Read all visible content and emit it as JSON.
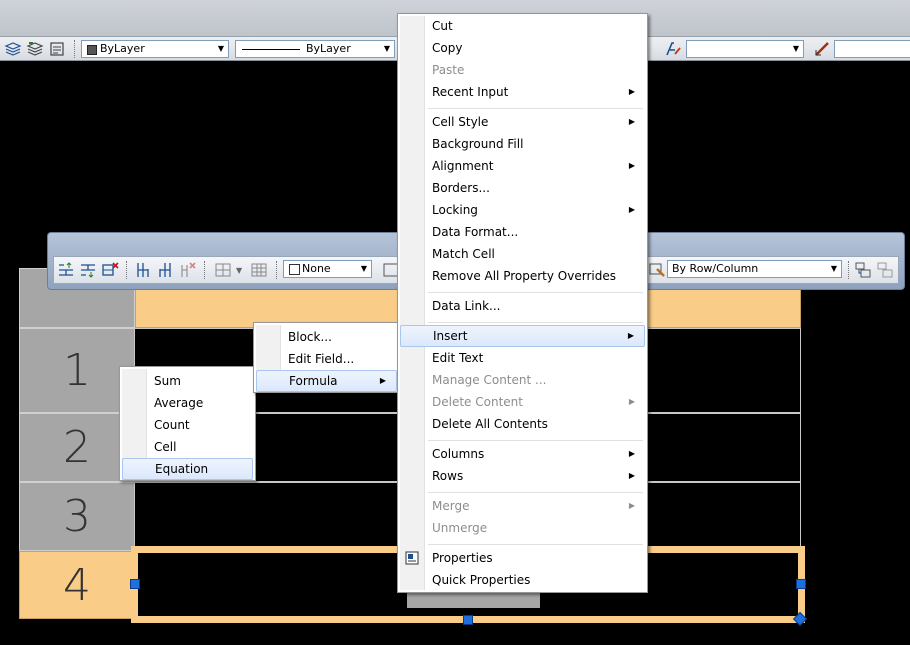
{
  "properties_toolbar": {
    "color_combo": "ByLayer",
    "linetype_combo": "ByLayer",
    "extra_combo": ""
  },
  "table": {
    "row_numbers": [
      "1",
      "2",
      "3",
      "4"
    ]
  },
  "table_toolbar": {
    "cell_style_combo": "None",
    "by_row_column_combo": "By Row/Column"
  },
  "context_menu": {
    "items": [
      {
        "label": "Cut"
      },
      {
        "label": "Copy"
      },
      {
        "label": "Paste",
        "disabled": true
      },
      {
        "label": "Recent Input",
        "submenu": true
      },
      {
        "label": "Cell Style",
        "submenu": true
      },
      {
        "label": "Background Fill"
      },
      {
        "label": "Alignment",
        "submenu": true
      },
      {
        "label": "Borders..."
      },
      {
        "label": "Locking",
        "submenu": true
      },
      {
        "label": "Data Format..."
      },
      {
        "label": "Match Cell"
      },
      {
        "label": "Remove All Property Overrides"
      },
      {
        "label": "Data Link..."
      },
      {
        "label": "Insert",
        "submenu": true,
        "highlighted": true
      },
      {
        "label": "Edit Text"
      },
      {
        "label": "Manage Content ...",
        "disabled": true
      },
      {
        "label": "Delete Content",
        "submenu": true,
        "disabled": true
      },
      {
        "label": "Delete All Contents"
      },
      {
        "label": "Columns",
        "submenu": true
      },
      {
        "label": "Rows",
        "submenu": true
      },
      {
        "label": "Merge",
        "submenu": true,
        "disabled": true
      },
      {
        "label": "Unmerge",
        "disabled": true
      },
      {
        "label": "Properties"
      },
      {
        "label": "Quick Properties"
      }
    ]
  },
  "insert_submenu": {
    "items": [
      {
        "label": "Block..."
      },
      {
        "label": "Edit Field..."
      },
      {
        "label": "Formula",
        "submenu": true,
        "highlighted": true
      }
    ]
  },
  "formula_submenu": {
    "items": [
      {
        "label": "Sum"
      },
      {
        "label": "Average"
      },
      {
        "label": "Count"
      },
      {
        "label": "Cell"
      },
      {
        "label": "Equation",
        "highlighted": true
      }
    ]
  },
  "colors": {
    "selection_orange": "#f9cc88",
    "grip_blue": "#1e6fe0",
    "menu_highlight_border": "#a9c6ef"
  }
}
